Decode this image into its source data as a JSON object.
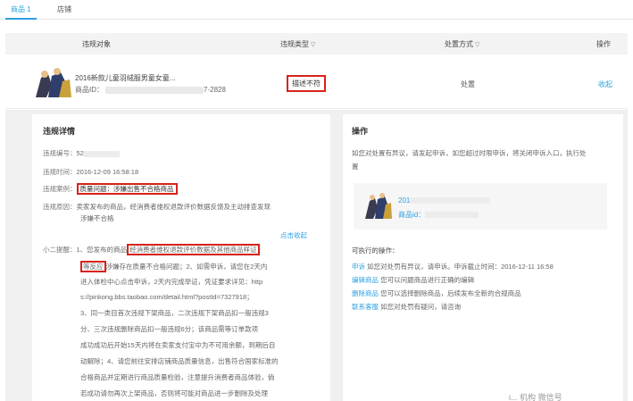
{
  "tabs": [
    {
      "label": "商品 1"
    },
    {
      "label": "店铺"
    }
  ],
  "table": {
    "headers": {
      "object": "违规对象",
      "type": "违规类型",
      "method": "处置方式",
      "op": "操作"
    },
    "row": {
      "title": "2016新款儿童羽绒服男童女童...",
      "id_label": "商品ID：",
      "id_suffix": "7-2828",
      "violation_type": "描述不符",
      "method": "处置",
      "op_link": "收起"
    }
  },
  "detail": {
    "title": "违规详情",
    "number_label": "违规编号：",
    "number_value": "52",
    "time_label": "违规时间：",
    "time_value": "2016-12-09 16:58:18",
    "case_label": "违规案例：",
    "case_value": "质量问题：涉嫌出售不合格商品",
    "reason_label": "违规原因：",
    "reason_value_1": "卖家发布的商品，经消费者维权退款评价数据反馈及主动排查发现",
    "reason_value_2": "涉嫌不合格",
    "expand_link": "点击收起",
    "tips_label": "小二提醒：",
    "tips_1a": "1、您发布的商品",
    "tips_1b": "经消费者维权退款评价数据及其他商品样证",
    "tips_2a": "等反应",
    "tips_2b": "涉嫌存在质量不合格问题；2、如需申诉，请您在2天内",
    "tips_3": "进入体检中心点击申诉，2天内完成举证，凭证要求详见：http",
    "tips_4": "s://pinkong.bbs.taobao.com/detail.html?postId=7327918；",
    "tips_5": "3、同一类目首次违规下架商品，二次违规下架商品扣一般违规3",
    "tips_6": "分、三次违规删除商品扣一般违规6分；该商品需等订单款项",
    "tips_7": "成功成功后开始15天内将在卖家支付宝中为不可用余额，到期后自",
    "tips_8": "动解除；4、请您前往安排店铺商品质量信息，出售符合国家标准的",
    "tips_9": "合格商品并定期进行商品质量检验，注意提升消费者商品体验，倘",
    "tips_10": "若成功请勿再次上架商品，否则将可能对商品进一步删除及处理"
  },
  "ops": {
    "title": "操作",
    "desc_1": "如您对处置有异议，请发起申诉，如您超过时限申诉，将关闭申诉入口，执行处",
    "desc_2": "置",
    "mini_title": "201",
    "mini_id_label": "商品id：",
    "exec_title": "可执行的操作：",
    "actions": [
      {
        "link": "申诉",
        "desc": "如您对处罚有异议，请申诉。申诉截止时间：2016-12-11 16:58"
      },
      {
        "link": "编辑商品",
        "desc": "您可以问题商品进行正确的编辑"
      },
      {
        "link": "删除商品",
        "desc": "您可以选择删除商品，后续发布全新的合规商品"
      },
      {
        "link": "联系客服",
        "desc": "如您对处罚有疑问，请咨询"
      }
    ]
  },
  "watermark": "i... 机构 微信号"
}
